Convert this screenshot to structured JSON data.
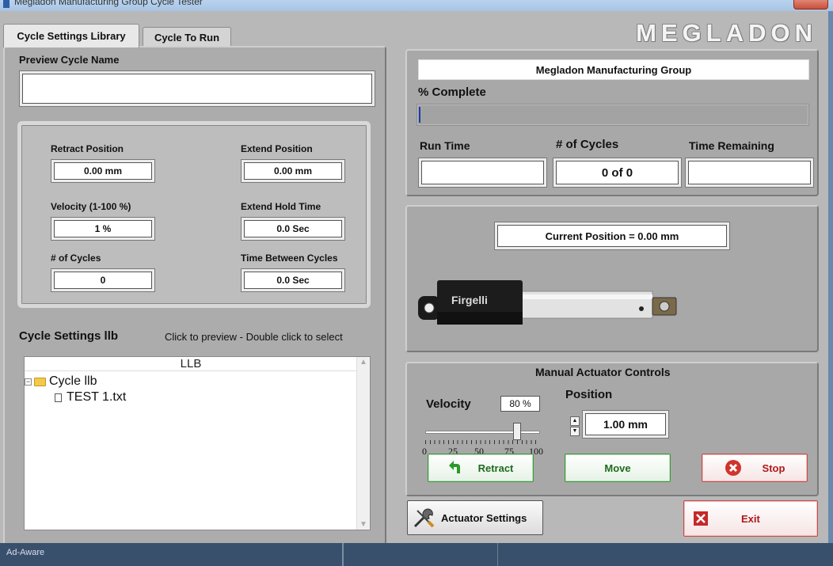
{
  "window": {
    "title": "Megladon Manufacturing Group Cycle Tester"
  },
  "tabs": [
    {
      "label": "Cycle Settings Library",
      "active": true
    },
    {
      "label": "Cycle To Run",
      "active": false
    }
  ],
  "brand": "MEGLADON",
  "preview": {
    "label": "Preview Cycle Name",
    "value": ""
  },
  "settings": {
    "retract_label": "Retract Position",
    "retract_value": "0.00 mm",
    "extend_label": "Extend Position",
    "extend_value": "0.00 mm",
    "velocity_label": "Velocity (1-100 %)",
    "velocity_value": "1 %",
    "hold_label": "Extend Hold Time",
    "hold_value": "0.0 Sec",
    "cycles_label": "# of Cycles",
    "cycles_value": "0",
    "between_label": "Time Between Cycles",
    "between_value": "0.0 Sec"
  },
  "library": {
    "title": "Cycle Settings llb",
    "hint": "Click to preview - Double click to select",
    "header": "LLB",
    "folder": "Cycle llb",
    "file": "TEST 1.txt"
  },
  "status": {
    "company": "Megladon Manufacturing Group",
    "complete_label": "% Complete",
    "progress_percent": 0,
    "runtime_label": "Run Time",
    "runtime_value": "",
    "cycles_label": "# of Cycles",
    "cycles_value": "0 of 0",
    "remaining_label": "Time Remaining",
    "remaining_value": ""
  },
  "position": {
    "readout": "Current Position = 0.00 mm",
    "actuator_brand": "Firgelli"
  },
  "manual": {
    "title": "Manual Actuator Controls",
    "velocity_label": "Velocity",
    "velocity_value": "80 %",
    "velocity_percent": 80,
    "scale": [
      "0",
      "25",
      "50",
      "75",
      "100"
    ],
    "position_label": "Position",
    "position_value": "1.00 mm",
    "retract_label": "Retract",
    "move_label": "Move",
    "stop_label": "Stop"
  },
  "footer": {
    "settings_label": "Actuator Settings",
    "exit_label": "Exit"
  },
  "taskbar": {
    "item": "Ad-Aware"
  },
  "colors": {
    "accent_green": "#1e6b1e",
    "accent_red": "#b01818",
    "progress": "#1a3aa8"
  }
}
